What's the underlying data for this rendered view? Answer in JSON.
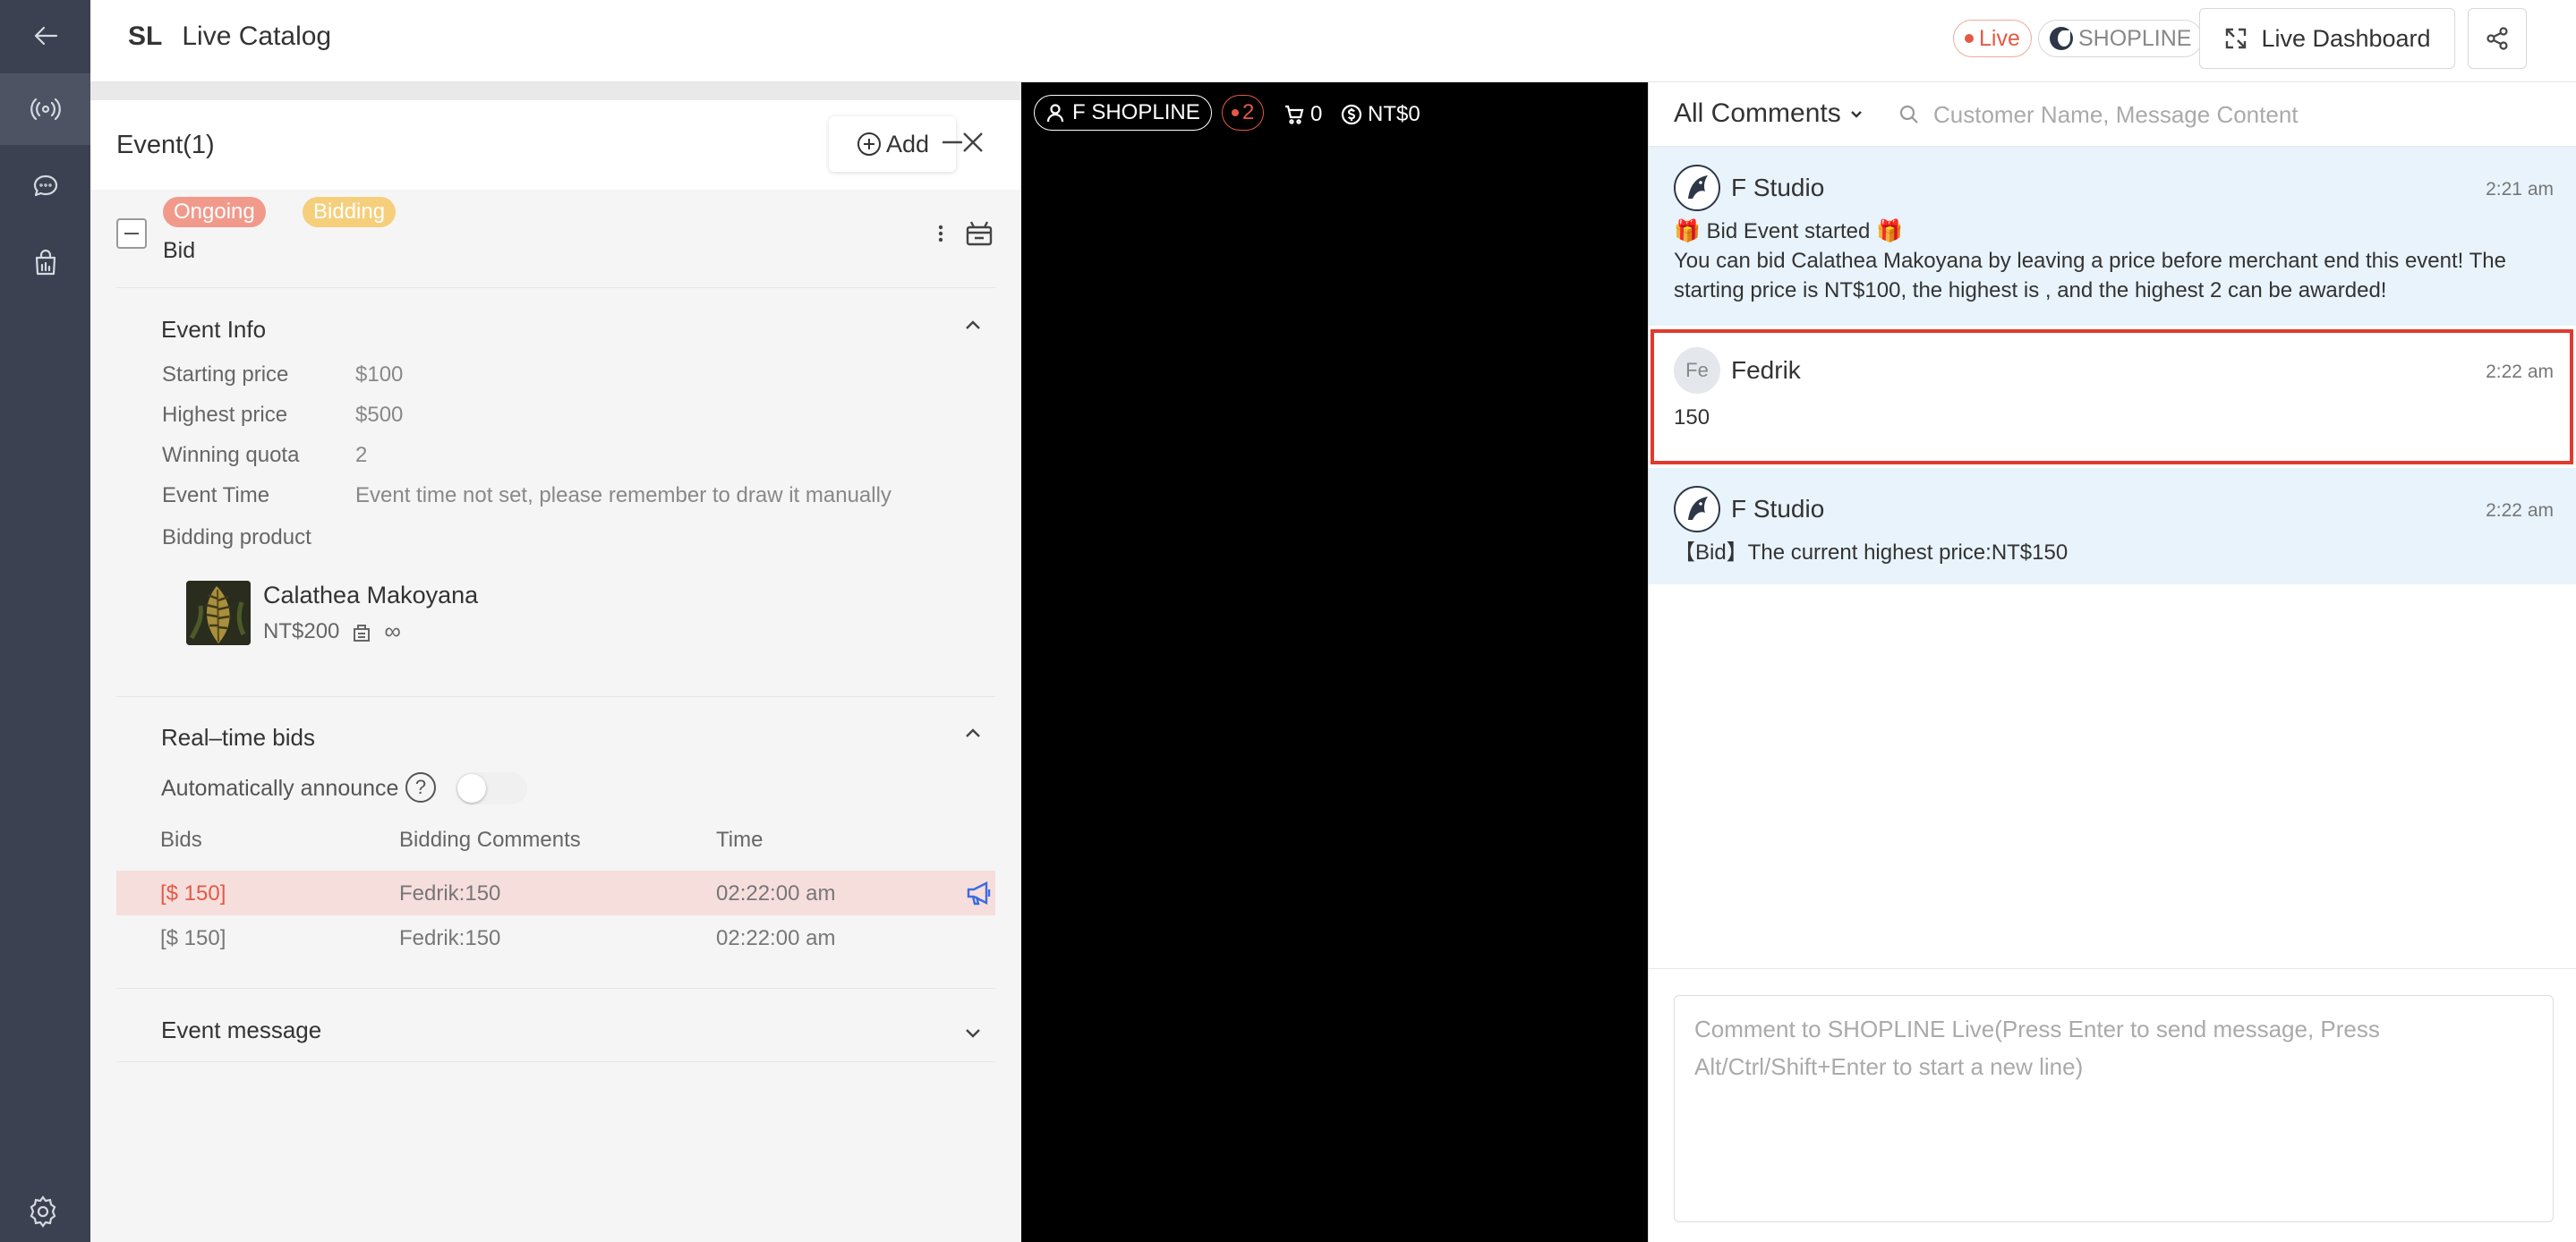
{
  "header": {
    "brand_abbr": "SL",
    "title": "Live Catalog",
    "live_label": "Live",
    "platform_label": "SHOPLINE",
    "dashboard_label": "Live Dashboard"
  },
  "event_panel": {
    "title": "Event(1)",
    "add_label": "Add",
    "event": {
      "tags": [
        "Ongoing",
        "Bidding"
      ],
      "name": "Bid"
    },
    "info": {
      "section_title": "Event Info",
      "rows": [
        {
          "label": "Starting price",
          "value": "$100"
        },
        {
          "label": "Highest price",
          "value": "$500"
        },
        {
          "label": "Winning quota",
          "value": "2"
        },
        {
          "label": "Event Time",
          "value": "Event time not set, please remember to draw it manually"
        }
      ],
      "product_label": "Bidding product",
      "product": {
        "name": "Calathea Makoyana",
        "price": "NT$200",
        "stock": "∞"
      }
    },
    "bids": {
      "section_title": "Real–time bids",
      "auto_announce_label": "Automatically announce",
      "auto_announce_on": false,
      "columns": [
        "Bids",
        "Bidding Comments",
        "Time"
      ],
      "rows": [
        {
          "bid": "[$ 150]",
          "comment": "Fedrik:150",
          "time": "02:22:00 am"
        },
        {
          "bid": "[$ 150]",
          "comment": "Fedrik:150",
          "time": "02:22:00 am"
        }
      ]
    },
    "message_section_title": "Event message"
  },
  "video": {
    "account": "F SHOPLINE",
    "viewers": "2",
    "cart_count": "0",
    "revenue": "NT$0"
  },
  "comments": {
    "filter_label": "All Comments",
    "search_placeholder": "Customer Name, Message Content",
    "messages": [
      {
        "author": "F Studio",
        "time": "2:21 am",
        "line1": "🎁 Bid Event started 🎁",
        "line2": "You can bid Calathea Makoyana by leaving a price before merchant end this event! The",
        "line3": "starting price is NT$100, the highest is , and the highest 2 can be awarded!"
      },
      {
        "author": "Fedrik",
        "initials": "Fe",
        "time": "2:22 am",
        "text": "150"
      },
      {
        "author": "F Studio",
        "time": "2:22 am",
        "text": "【Bid】The current highest price:NT$150"
      }
    ],
    "composer_placeholder": "Comment to SHOPLINE Live(Press Enter to send message, Press Alt/Ctrl/Shift+Enter to start a new line)"
  },
  "colors": {
    "sidebar": "#3b4150",
    "live_red": "#e25a45",
    "bot_message_bg": "#e8f3fb",
    "highlight_border": "#e03a2f",
    "announce_blue": "#3d6be0"
  }
}
